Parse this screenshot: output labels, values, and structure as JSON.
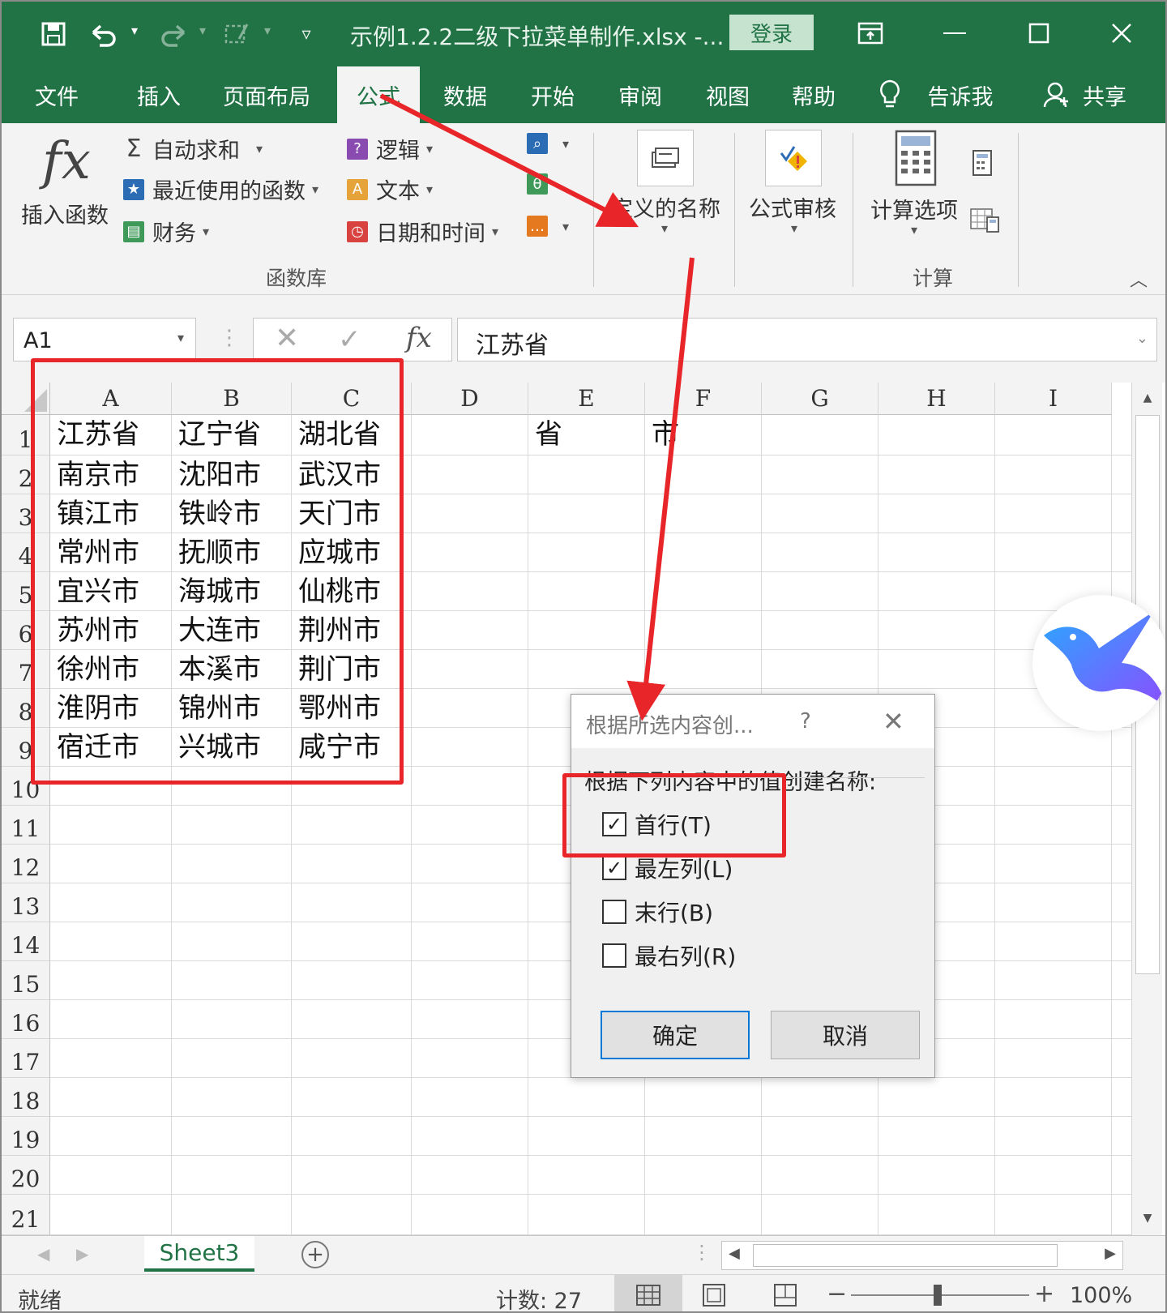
{
  "titlebar": {
    "doc_title": "示例1.2.2二级下拉菜单制作.xlsx  -...",
    "login": "登录"
  },
  "tabs": [
    {
      "label": "文件"
    },
    {
      "label": "插入"
    },
    {
      "label": "页面布局"
    },
    {
      "label": "公式"
    },
    {
      "label": "数据"
    },
    {
      "label": "开始"
    },
    {
      "label": "审阅"
    },
    {
      "label": "视图"
    },
    {
      "label": "帮助"
    },
    {
      "label": "告诉我"
    },
    {
      "label": "共享"
    }
  ],
  "ribbon": {
    "insert_function": "插入函数",
    "autosum": "自动求和",
    "recent": "最近使用的函数",
    "financial": "财务",
    "logical": "逻辑",
    "text": "文本",
    "datetime": "日期和时间",
    "function_library": "函数库",
    "defined_names": "定义的名称",
    "formula_auditing": "公式审核",
    "calc_options": "计算选项",
    "calculation": "计算"
  },
  "formula_bar": {
    "name_box": "A1",
    "formula": "江苏省"
  },
  "columns": [
    "A",
    "B",
    "C",
    "D",
    "E",
    "F",
    "G",
    "H",
    "I"
  ],
  "rows": [
    "1",
    "2",
    "3",
    "4",
    "5",
    "6",
    "7",
    "8",
    "9",
    "10",
    "11",
    "12",
    "13",
    "14",
    "15",
    "16",
    "17",
    "18",
    "19",
    "20",
    "21"
  ],
  "cells": {
    "A": [
      "江苏省",
      "南京市",
      "镇江市",
      "常州市",
      "宜兴市",
      "苏州市",
      "徐州市",
      "淮阴市",
      "宿迁市"
    ],
    "B": [
      "辽宁省",
      "沈阳市",
      "铁岭市",
      "抚顺市",
      "海城市",
      "大连市",
      "本溪市",
      "锦州市",
      "兴城市"
    ],
    "C": [
      "湖北省",
      "武汉市",
      "天门市",
      "应城市",
      "仙桃市",
      "荆州市",
      "荆门市",
      "鄂州市",
      "咸宁市"
    ],
    "E1": "省",
    "F1": "市"
  },
  "dialog": {
    "title": "根据所选内容创...",
    "help": "?",
    "prompt": "根据下列内容中的值创建名称:",
    "options": [
      {
        "label": "首行(T)",
        "checked": true
      },
      {
        "label": "最左列(L)",
        "checked": true
      },
      {
        "label": "末行(B)",
        "checked": false
      },
      {
        "label": "最右列(R)",
        "checked": false
      }
    ],
    "ok": "确定",
    "cancel": "取消"
  },
  "sheet_tab": "Sheet3",
  "status": {
    "ready": "就绪",
    "count": "计数: 27",
    "zoom": "100%"
  },
  "colors": {
    "excel_green": "#217346",
    "annotation_red": "#e8262a"
  }
}
